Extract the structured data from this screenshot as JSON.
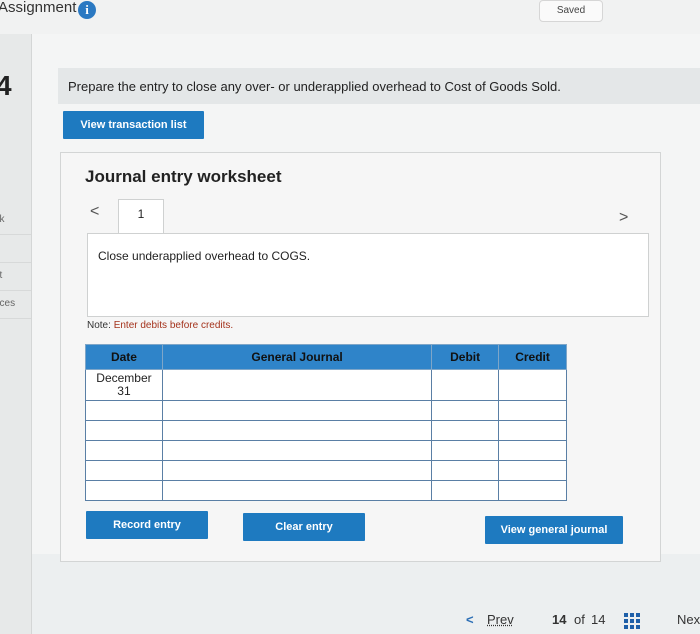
{
  "header": {
    "title": "Assignment",
    "info_icon": "info-icon",
    "saved": "Saved"
  },
  "sidebar": {
    "question_number": "4",
    "items": [
      {
        "label": "ok"
      },
      {
        "label": "t"
      },
      {
        "label": "nt"
      },
      {
        "label": "nces"
      }
    ]
  },
  "question": {
    "prompt": "Prepare the entry to close any over- or underapplied overhead to Cost of Goods Sold.",
    "view_transactions": "View transaction list"
  },
  "worksheet": {
    "title": "Journal entry worksheet",
    "tab": "1",
    "description": "Close underapplied overhead to COGS.",
    "note_prefix": "Note: ",
    "note": "Enter debits before credits.",
    "columns": [
      "Date",
      "General Journal",
      "Debit",
      "Credit"
    ],
    "rows": [
      {
        "date": "December\n31",
        "account": "",
        "debit": "",
        "credit": ""
      },
      {
        "date": "",
        "account": "",
        "debit": "",
        "credit": ""
      },
      {
        "date": "",
        "account": "",
        "debit": "",
        "credit": ""
      },
      {
        "date": "",
        "account": "",
        "debit": "",
        "credit": ""
      },
      {
        "date": "",
        "account": "",
        "debit": "",
        "credit": ""
      },
      {
        "date": "",
        "account": "",
        "debit": "",
        "credit": ""
      }
    ],
    "buttons": {
      "record": "Record entry",
      "clear": "Clear entry",
      "view_general": "View general journal"
    }
  },
  "footer": {
    "prev": "Prev",
    "page_current": "14",
    "page_of": "of",
    "page_total": "14",
    "next": "Nex"
  },
  "colors": {
    "accent": "#1e7ac0",
    "table_header": "#2f84c9",
    "note_red": "#a4321b"
  }
}
